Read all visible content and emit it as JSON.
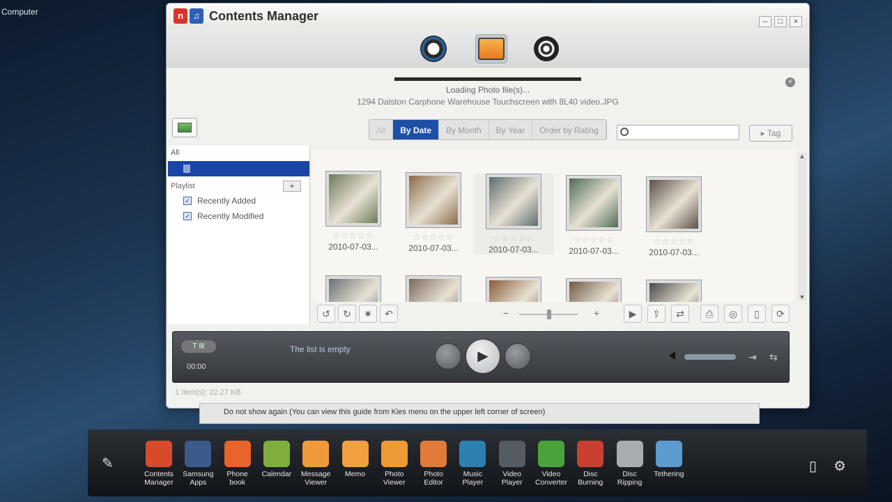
{
  "desktop": {
    "label": "Computer"
  },
  "window": {
    "title": "Contents Manager",
    "buttons": {
      "minimize": "–",
      "maximize": "□",
      "close": "×"
    }
  },
  "modes": [
    {
      "name": "music-mode-icon"
    },
    {
      "name": "photo-mode-icon",
      "active": true
    },
    {
      "name": "video-mode-icon"
    }
  ],
  "loading": {
    "status": "Loading Photo file(s)...",
    "file": "1294 Dalston Carphone Warehouse Touchscreen with 8L40 video.JPG",
    "close": "×"
  },
  "filters": {
    "all": "All",
    "by_date": "By Date",
    "by_month": "By Month",
    "by_year": "By Year",
    "order_by_rating": "Order by Rating"
  },
  "search": {
    "placeholder": "",
    "value": ""
  },
  "tag_button": "Tag",
  "sidebar": {
    "all": "All",
    "playlist": "Playlist",
    "add": "+",
    "items": [
      {
        "label": "Recently Added",
        "checked": "✓"
      },
      {
        "label": "Recently Modified",
        "checked": "✓"
      }
    ]
  },
  "thumbnails": [
    {
      "date": "2010-07-03...",
      "stars": "☆☆☆☆☆",
      "color": "#6f7a5a"
    },
    {
      "date": "2010-07-03...",
      "stars": "☆☆☆☆☆",
      "color": "#8b6b4a"
    },
    {
      "date": "2010-07-03...",
      "stars": "☆☆☆☆☆",
      "color": "#5f6d70"
    },
    {
      "date": "2010-07-03...",
      "stars": "☆☆☆☆☆",
      "color": "#4f6b56"
    },
    {
      "date": "2010-07-03...",
      "stars": "☆☆☆☆☆",
      "color": "#5a4f48"
    },
    {
      "date": "",
      "stars": "",
      "color": "#6a6e72"
    },
    {
      "date": "",
      "stars": "",
      "color": "#7a6a5c"
    },
    {
      "date": "",
      "stars": "",
      "color": "#8a5a3a"
    },
    {
      "date": "",
      "stars": "",
      "color": "#6f5a44"
    },
    {
      "date": "",
      "stars": "",
      "color": "#4a4a4c"
    }
  ],
  "player": {
    "status": "The list is empty",
    "time": "00:00",
    "badge": "T ⊞",
    "play": "▶"
  },
  "statusbar": "1 Item(s): 22.27 KB",
  "guide": "Do not show again (You can view this guide from Kies menu on the upper left corner of screen)",
  "dock": [
    {
      "label": "Contents\nManager",
      "color": "#d84a2a"
    },
    {
      "label": "Samsung\nApps",
      "color": "#3c5a8a"
    },
    {
      "label": "Phone\nbook",
      "color": "#e8642a"
    },
    {
      "label": "Calendar",
      "color": "#7fae3c"
    },
    {
      "label": "Message\nViewer",
      "color": "#ef9a3a"
    },
    {
      "label": "Memo",
      "color": "#f0a040"
    },
    {
      "label": "Photo\nViewer",
      "color": "#ee9a34"
    },
    {
      "label": "Photo\nEditor",
      "color": "#e07a36"
    },
    {
      "label": "Music\nPlayer",
      "color": "#2d7fb0"
    },
    {
      "label": "Video\nPlayer",
      "color": "#555b62"
    },
    {
      "label": "Video\nConverter",
      "color": "#4aa23a"
    },
    {
      "label": "Disc\nBurning",
      "color": "#c94030"
    },
    {
      "label": "Disc\nRipping",
      "color": "#a8adb2"
    },
    {
      "label": "Tethering",
      "color": "#5b9bd0"
    }
  ]
}
